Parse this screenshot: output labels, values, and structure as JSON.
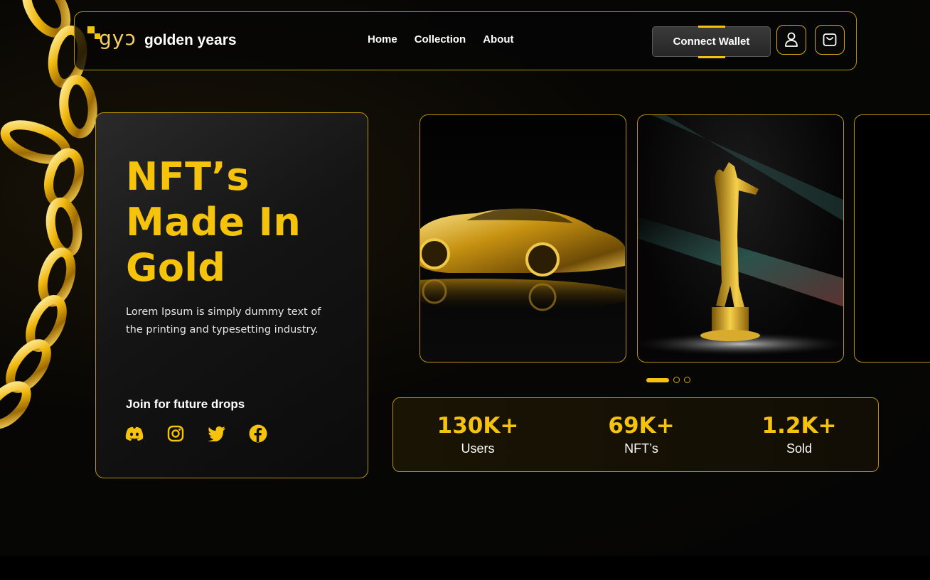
{
  "colors": {
    "accent": "#f5c20c",
    "border": "#b8900e",
    "background": "#050505",
    "text": "#ffffff"
  },
  "header": {
    "logo_mark": "gyɔ",
    "brand_name": "golden years",
    "nav": [
      {
        "label": "Home"
      },
      {
        "label": "Collection"
      },
      {
        "label": "About"
      }
    ],
    "connect_wallet_label": "Connect Wallet",
    "user_icon": "user-icon",
    "cart_icon": "shopping-bag-icon"
  },
  "hero": {
    "title_lines": [
      "NFT’s",
      "Made In",
      "Gold"
    ],
    "description": "Lorem Ipsum is simply dummy text of the printing and typesetting industry.",
    "join_label": "Join for future drops",
    "socials": [
      {
        "name": "discord-icon"
      },
      {
        "name": "instagram-icon"
      },
      {
        "name": "twitter-icon"
      },
      {
        "name": "facebook-icon"
      }
    ]
  },
  "carousel": {
    "items": [
      {
        "subject": "gold-sports-car"
      },
      {
        "subject": "gold-statue-trophy"
      },
      {
        "subject": "partial-card"
      }
    ],
    "active_index": 0,
    "page_count": 3
  },
  "stats": [
    {
      "value": "130K+",
      "label": "Users"
    },
    {
      "value": "69K+",
      "label": "NFT’s"
    },
    {
      "value": "1.2K+",
      "label": "Sold"
    }
  ]
}
